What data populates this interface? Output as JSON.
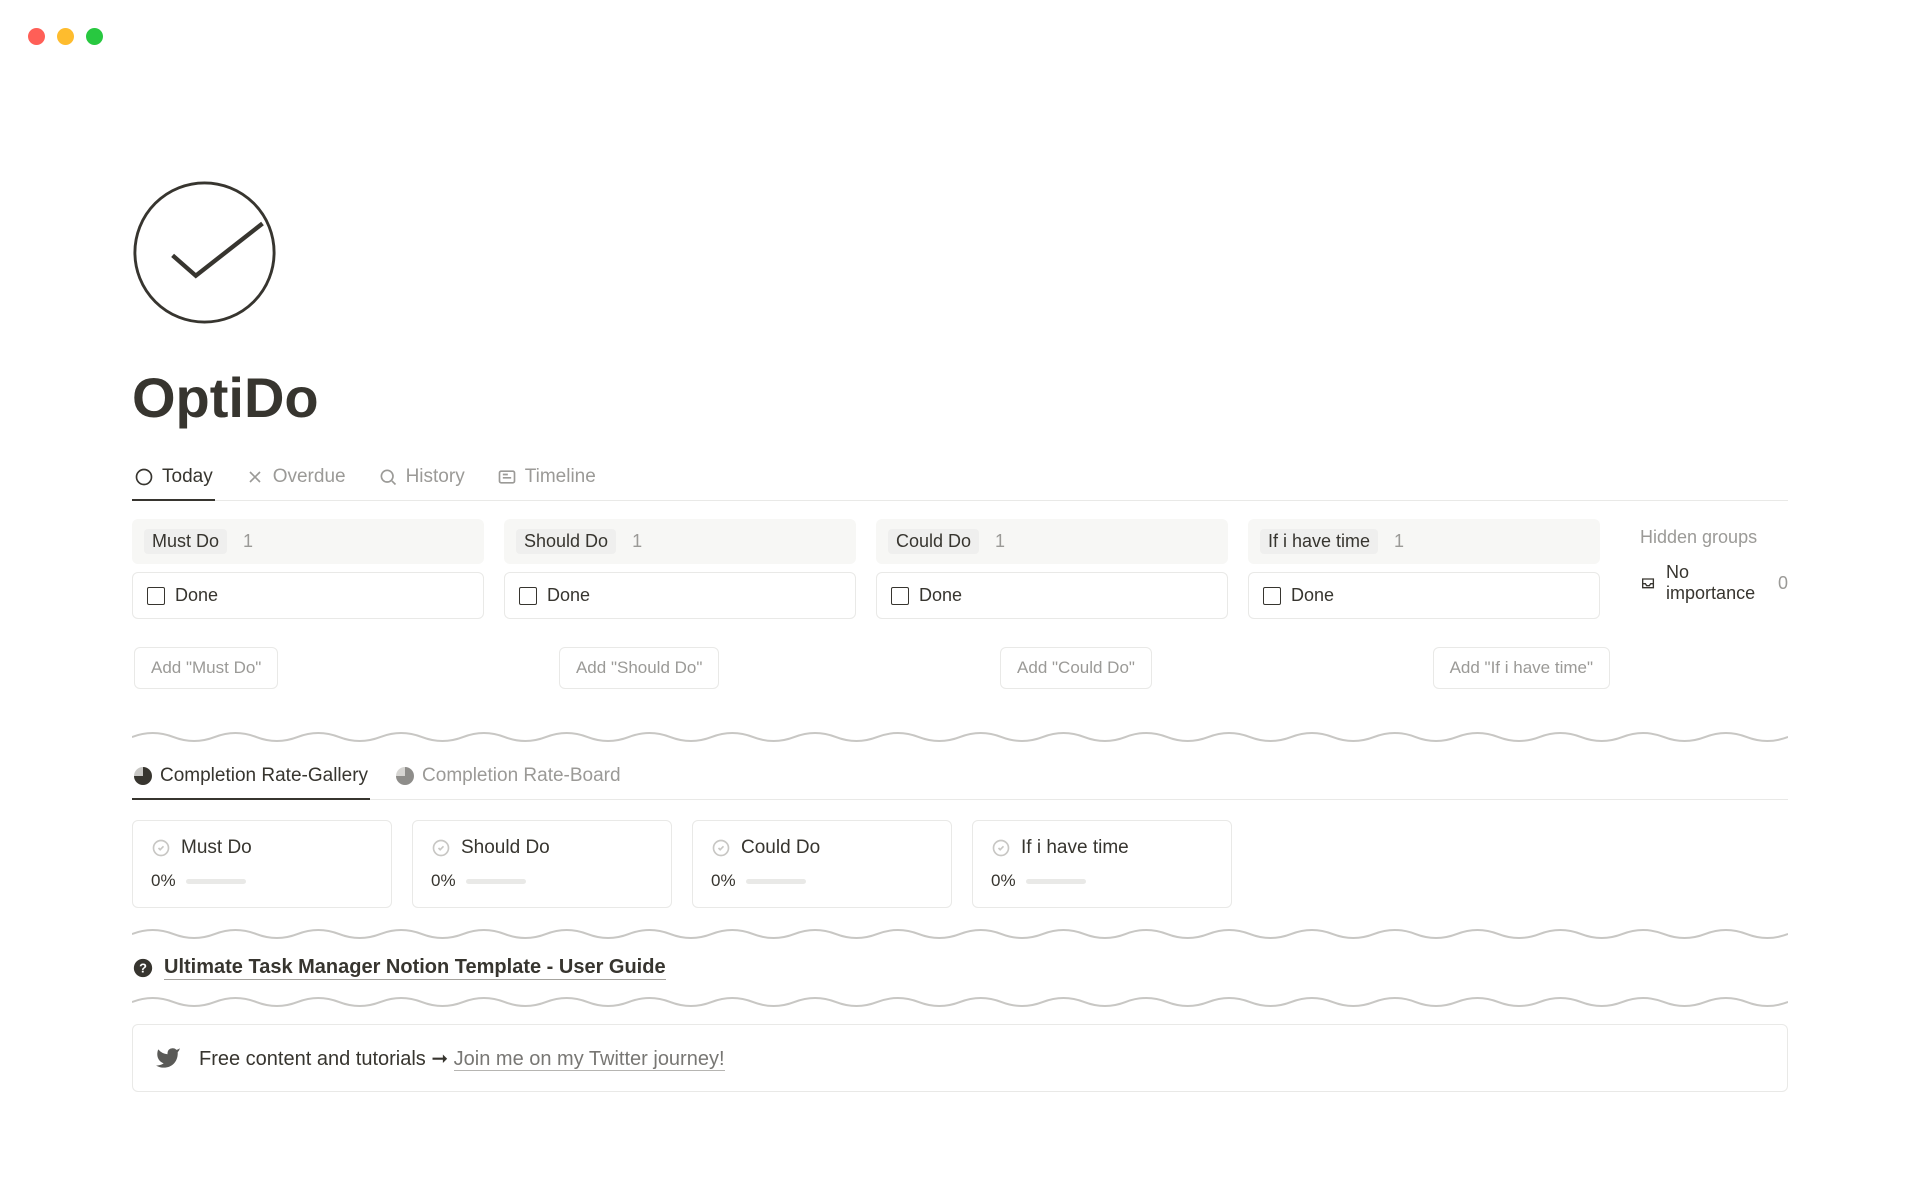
{
  "page": {
    "title": "OptiDo"
  },
  "tabs": {
    "today": "Today",
    "overdue": "Overdue",
    "history": "History",
    "timeline": "Timeline"
  },
  "board": {
    "columns": [
      {
        "label": "Must Do",
        "count": "1",
        "card": "Done"
      },
      {
        "label": "Should Do",
        "count": "1",
        "card": "Done"
      },
      {
        "label": "Could Do",
        "count": "1",
        "card": "Done"
      },
      {
        "label": "If i have time",
        "count": "1",
        "card": "Done"
      }
    ],
    "hidden": {
      "title": "Hidden groups",
      "item": "No importance",
      "count": "0"
    },
    "add_buttons": [
      "Add \"Must Do\"",
      "Add \"Should Do\"",
      "Add \"Could Do\"",
      "Add \"If i have time\""
    ]
  },
  "completion_tabs": {
    "gallery": "Completion Rate-Gallery",
    "board": "Completion Rate-Board"
  },
  "gallery": [
    {
      "label": "Must Do",
      "pct": "0%"
    },
    {
      "label": "Should Do",
      "pct": "0%"
    },
    {
      "label": "Could Do",
      "pct": "0%"
    },
    {
      "label": "If i have time",
      "pct": "0%"
    }
  ],
  "guide": {
    "label": "Ultimate Task Manager Notion Template - User Guide"
  },
  "callout": {
    "prefix": "Free content and tutorials ➞ ",
    "link": "Join me on my Twitter journey!"
  }
}
